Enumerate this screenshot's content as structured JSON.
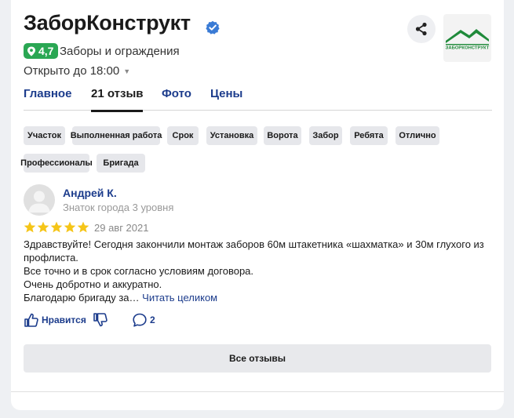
{
  "org": {
    "name": "ЗаборКонструкт",
    "rating": "4,7",
    "category": "Заборы и ограждения",
    "hours": "Открыто до 18:00",
    "logo_text": "ЗАБОРКОНСТРУКТ"
  },
  "tabs": [
    {
      "label": "Главное",
      "active": false
    },
    {
      "label": "21 отзыв",
      "active": true
    },
    {
      "label": "Фото",
      "active": false
    },
    {
      "label": "Цены",
      "active": false
    }
  ],
  "tags": [
    "Участок",
    "Выполненная работа",
    "Срок",
    "Установка",
    "Ворота",
    "Забор",
    "Ребята",
    "Отлично",
    "Профессионалы",
    "Бригада"
  ],
  "review": {
    "author": "Андрей К.",
    "level": "Знаток города 3 уровня",
    "rating": 5,
    "date": "29 авг 2021",
    "lines": [
      "Здравствуйте! Сегодня закончили монтаж заборов 60м штакетника «шахматка» и 30м глухого из",
      "профлиста.",
      "Все точно и в срок согласно условиям договора.",
      "Очень добротно и аккуратно.",
      "Благодарю бригаду за…"
    ],
    "read_more": "Читать целиком",
    "like_label": "Нравится",
    "comments_count": "2"
  },
  "all_reviews_label": "Все отзывы",
  "colors": {
    "accent_link": "#1c3c8c",
    "rating_green": "#2aa753",
    "verified_blue": "#3a7bd5",
    "star_yellow": "#f5c518",
    "logo_green": "#1f8a3a"
  },
  "icons": {
    "verified": "verified-check-icon",
    "pin": "map-pin-icon",
    "share": "share-icon",
    "like": "thumbs-up-icon",
    "dislike": "thumbs-down-icon",
    "comment": "comment-bubble-icon",
    "star": "star-icon"
  }
}
